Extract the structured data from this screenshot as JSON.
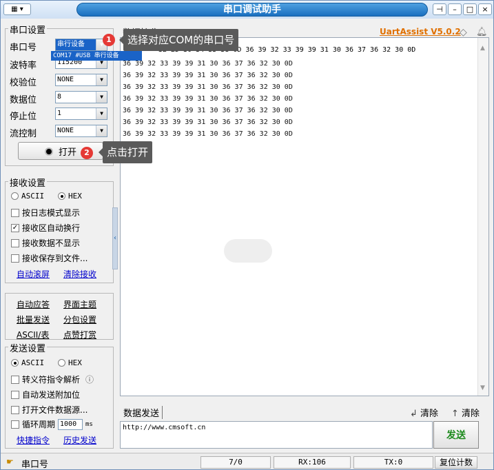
{
  "window": {
    "title": "串口调试助手",
    "sysmenu": "▦ ▾",
    "buttons": [
      "⊣",
      "–",
      "□",
      "×"
    ]
  },
  "serial": {
    "group_title": "串口设置",
    "port_label": "串口号",
    "port_value": "串行设备",
    "port_option": "COM17 #USB 串行设备",
    "baud_label": "波特率",
    "baud_value": "115200",
    "parity_label": "校验位",
    "parity_value": "NONE",
    "databits_label": "数据位",
    "databits_value": "8",
    "stopbits_label": "停止位",
    "stopbits_value": "1",
    "flow_label": "流控制",
    "flow_value": "NONE",
    "open_label": "打开"
  },
  "tooltips": {
    "step1_num": "1",
    "step1_text": "选择对应COM的串口号",
    "step2_num": "2",
    "step2_text": "点击打开"
  },
  "recv_settings": {
    "group_title": "接收设置",
    "ascii": "ASCII",
    "hex": "HEX",
    "log_mode": "按日志模式显示",
    "auto_wrap": "接收区自动换行",
    "hide_data": "接收数据不显示",
    "save_file": "接收保存到文件...",
    "auto_scroll": "自动滚屏",
    "clear_recv": "清除接收"
  },
  "tools": {
    "auto_reply": "自动应答",
    "theme": "界面主题",
    "batch_send": "批量发送",
    "subpkg": "分包设置",
    "ascii_table": "ASCII/表",
    "like": "点赞打赏"
  },
  "send_settings": {
    "group_title": "发送设置",
    "ascii": "ASCII",
    "hex": "HEX",
    "escape": "转义符指令解析",
    "info_icon": "ⓘ",
    "auto_append": "自动发送附加位",
    "open_file": "打开文件数据源...",
    "cycle": "循环周期",
    "cycle_value": "1000",
    "cycle_unit": "ms",
    "quick_cmd": "快捷指令",
    "history": "历史发送"
  },
  "recv": {
    "tab": "数据接收",
    "brand": "UartAssist V5.0.2",
    "lines": [
      "36 39 32 33 39 39 31 30 36 37 36 32 30 0D",
      "36 39 32 33 39 39 31 30 36 37 36 32 30 0D",
      "36 39 32 33 39 39 31 30 36 37 36 32 30 0D",
      "36 39 32 33 39 39 31 30 36 37 36 32 30 0D",
      "36 39 32 33 39 39 31 30 36 37 36 32 30 0D",
      "36 39 32 33 39 39 31 30 36 37 36 32 30 0D",
      "36 39 32 33 39 39 31 30 36 37 36 32 30 0D"
    ],
    "first_line": "32 2D 30 34 33 38 0D 36 39 32 33 39 39 31 30 36 37 36 32 30 0D"
  },
  "send": {
    "tab": "数据发送",
    "clear1": "清除",
    "clear2": "清除",
    "text": "http://www.cmsoft.cn",
    "button": "发送"
  },
  "status": {
    "port": "串口号",
    "count": "7/0",
    "rx": "RX:106",
    "tx": "TX:0",
    "reset": "复位计数"
  }
}
